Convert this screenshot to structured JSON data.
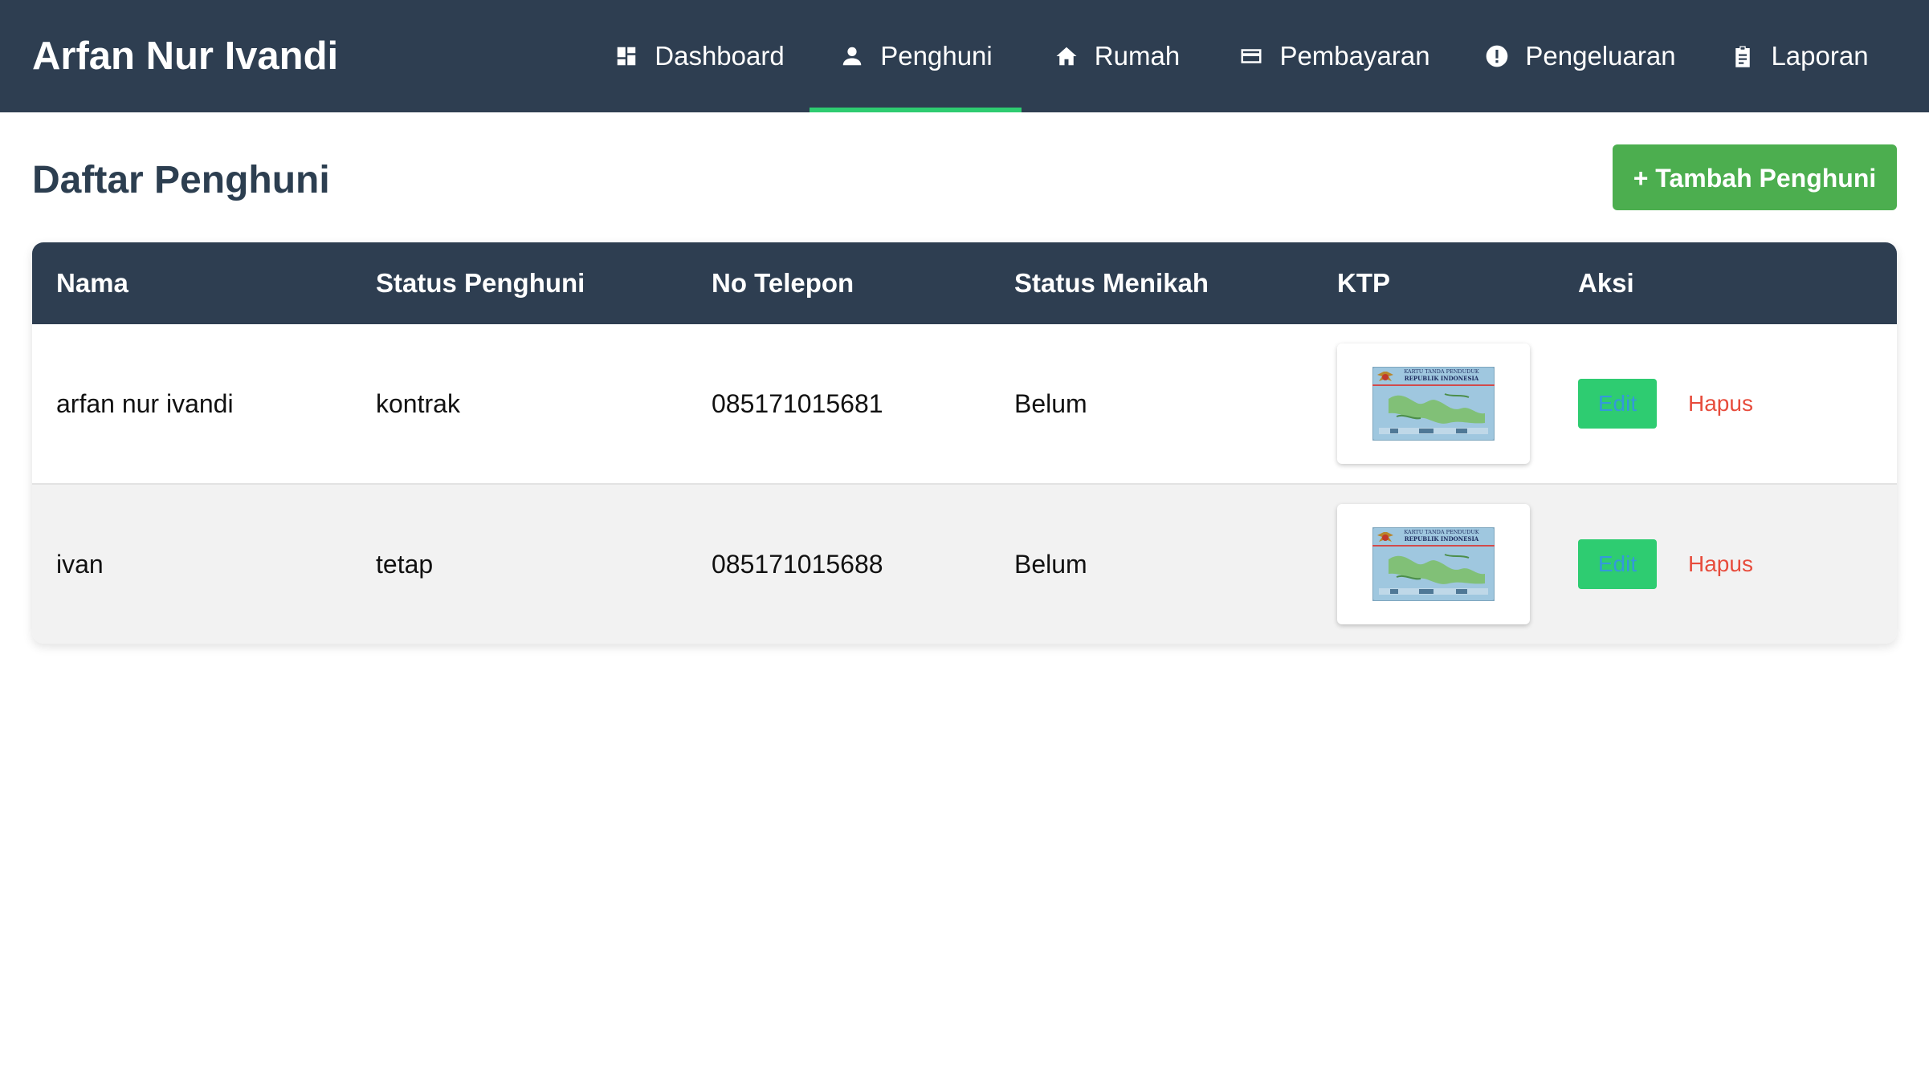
{
  "app": {
    "brand": "Arfan Nur Ivandi"
  },
  "nav": {
    "items": [
      {
        "label": "Dashboard",
        "icon": "dashboard-icon",
        "active": false
      },
      {
        "label": "Penghuni",
        "icon": "person-icon",
        "active": true
      },
      {
        "label": "Rumah",
        "icon": "home-icon",
        "active": false
      },
      {
        "label": "Pembayaran",
        "icon": "credit-card-icon",
        "active": false
      },
      {
        "label": "Pengeluaran",
        "icon": "alert-circle-icon",
        "active": false
      },
      {
        "label": "Laporan",
        "icon": "clipboard-icon",
        "active": false
      }
    ]
  },
  "page": {
    "title": "Daftar Penghuni",
    "add_button": "+ Tambah Penghuni"
  },
  "table": {
    "headers": [
      "Nama",
      "Status Penghuni",
      "No Telepon",
      "Status Menikah",
      "KTP",
      "Aksi"
    ],
    "rows": [
      {
        "nama": "arfan nur ivandi",
        "status_penghuni": "kontrak",
        "no_telepon": "085171015681",
        "status_menikah": "Belum",
        "ktp_image": "ktp-card-image",
        "edit_label": "Edit",
        "delete_label": "Hapus"
      },
      {
        "nama": "ivan",
        "status_penghuni": "tetap",
        "no_telepon": "085171015688",
        "status_menikah": "Belum",
        "ktp_image": "ktp-card-image",
        "edit_label": "Edit",
        "delete_label": "Hapus"
      }
    ]
  },
  "colors": {
    "navbar_bg": "#2e3e51",
    "active_underline": "#2ecc71",
    "add_button_bg": "#4cae4f",
    "edit_button_bg": "#2ecc71",
    "edit_text": "#3498db",
    "delete_text": "#e74c3c",
    "title_text": "#2c3e50",
    "striped_row": "#f2f2f2"
  },
  "ktp_text": {
    "line1": "KARTU TANDA PENDUDUK",
    "line2": "REPUBLIK INDONESIA"
  }
}
